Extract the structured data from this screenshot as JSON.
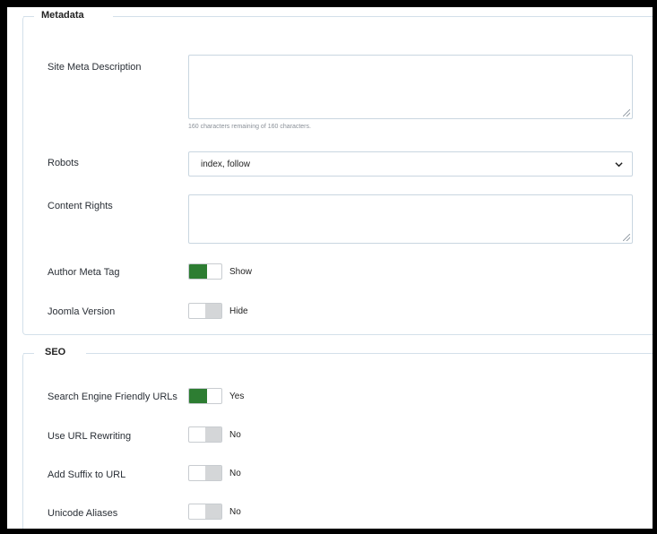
{
  "metadata": {
    "legend": "Metadata",
    "site_meta_description": {
      "label": "Site Meta Description",
      "value": "",
      "hint": "160 characters remaining of 160 characters."
    },
    "robots": {
      "label": "Robots",
      "value": "index, follow"
    },
    "content_rights": {
      "label": "Content Rights",
      "value": ""
    },
    "author_meta_tag": {
      "label": "Author Meta Tag",
      "state": "Show",
      "on": true
    },
    "joomla_version": {
      "label": "Joomla Version",
      "state": "Hide",
      "on": false
    }
  },
  "seo": {
    "legend": "SEO",
    "sef_urls": {
      "label": "Search Engine Friendly URLs",
      "state": "Yes",
      "on": true
    },
    "url_rewriting": {
      "label": "Use URL Rewriting",
      "state": "No",
      "on": false
    },
    "add_suffix": {
      "label": "Add Suffix to URL",
      "state": "No",
      "on": false
    },
    "unicode_aliases": {
      "label": "Unicode Aliases",
      "state": "No",
      "on": false
    }
  },
  "colors": {
    "toggle_on": "#2d7d32",
    "toggle_off": "#d4d6d8",
    "border": "#d3e0ea"
  }
}
